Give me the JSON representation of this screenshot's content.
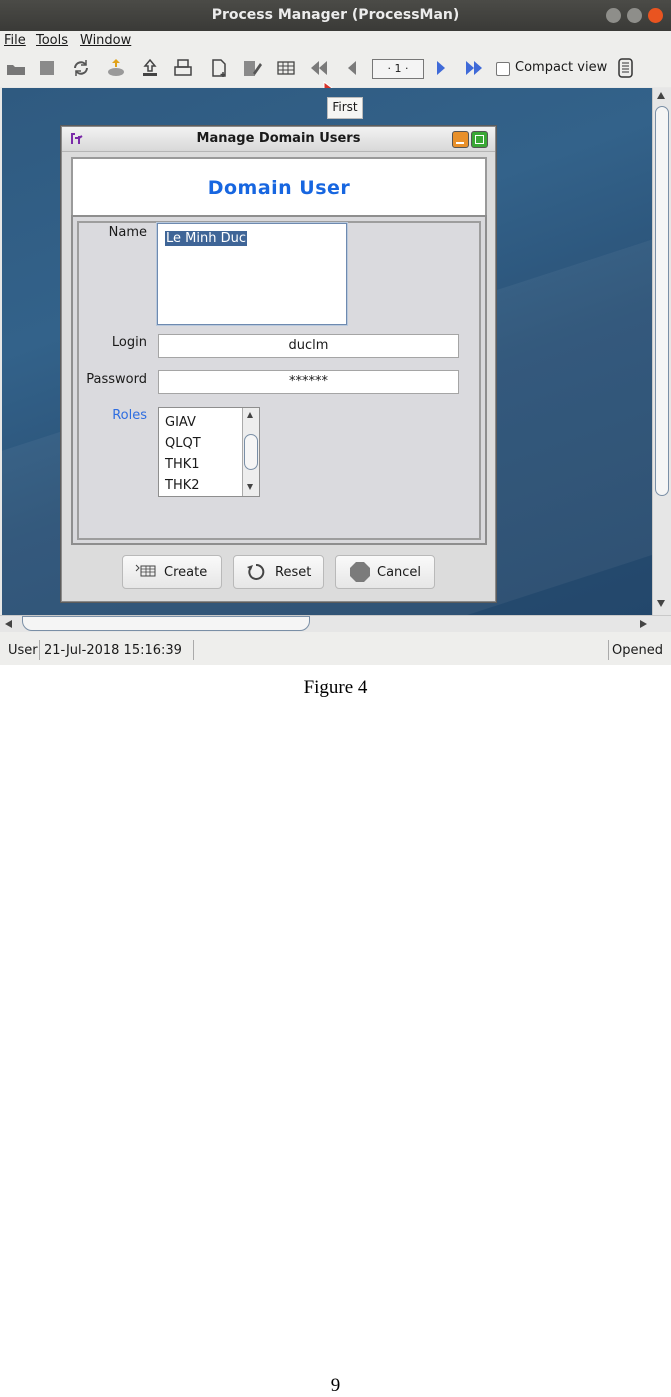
{
  "window": {
    "title": "Process Manager (ProcessMan)"
  },
  "menu": {
    "items": [
      "File",
      "Tools",
      "Window"
    ]
  },
  "toolbar": {
    "page_value": "· 1 ·",
    "compact_view_label": "Compact view",
    "compact_view_checked": false
  },
  "tooltip": {
    "text": "First"
  },
  "dialog": {
    "title": "Manage Domain Users",
    "header": "Domain User",
    "name_label": "Name",
    "name_value": "Le Minh Duc",
    "login_label": "Login",
    "login_value": "duclm",
    "password_label": "Password",
    "password_value": "******",
    "roles_label": "Roles",
    "roles": [
      "GIAV",
      "QLQT",
      "THK1",
      "THK2"
    ],
    "buttons": {
      "create": "Create",
      "reset": "Reset",
      "cancel": "Cancel"
    }
  },
  "statusbar": {
    "user": "User",
    "timestamp": "21-Jul-2018 15:16:39",
    "state": "Opened"
  },
  "document": {
    "caption": "Figure 4",
    "page_number": "9"
  },
  "colors": {
    "accent": "#1766e0",
    "roles_label": "#2e6de0",
    "selection": "#3f6597",
    "titlebar": "#3c3b37"
  }
}
